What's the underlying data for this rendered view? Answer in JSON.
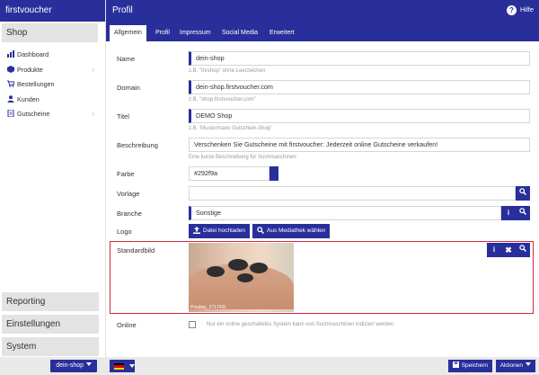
{
  "sidebar": {
    "brand": "firstvoucher",
    "section_shop": "Shop",
    "items": [
      {
        "label": "Dashboard",
        "icon": "dashboard-icon",
        "has_children": false
      },
      {
        "label": "Produkte",
        "icon": "box-icon",
        "has_children": true
      },
      {
        "label": "Bestellungen",
        "icon": "cart-icon",
        "has_children": false
      },
      {
        "label": "Kunden",
        "icon": "user-icon",
        "has_children": false
      },
      {
        "label": "Gutscheine",
        "icon": "document-icon",
        "has_children": true
      }
    ],
    "section_reporting": "Reporting",
    "section_settings": "Einstellungen",
    "section_system": "System",
    "shop_select": "dein-shop"
  },
  "header": {
    "title": "Profil",
    "help_label": "Hilfe",
    "tabs": [
      "Allgemein",
      "Profil",
      "Impressum",
      "Social Media",
      "Erweitert"
    ],
    "active_tab": "Allgemein"
  },
  "form": {
    "name": {
      "label": "Name",
      "value": "dein-shop",
      "hint": "z.B. \"ihrshop\" ohne Leerzeichen"
    },
    "domain": {
      "label": "Domain",
      "value": "dein-shop.firstvoucher.com",
      "hint": "z.B. \"shop.firstvoucher.com\""
    },
    "titel": {
      "label": "Titel",
      "value": "DEMO Shop",
      "hint": "z.B. 'Mustermann Gutschein-Shop'"
    },
    "beschreibung": {
      "label": "Beschreibung",
      "value": "Verschenken Sie Gutscheine mit firstvoucher: Jederzeit online Gutscheine verkaufen!",
      "hint": "Eine kurze Beschreibung für Suchmaschinen"
    },
    "farbe": {
      "label": "Farbe",
      "value": "#292f9a"
    },
    "vorlage": {
      "label": "Vorlage",
      "value": ""
    },
    "branche": {
      "label": "Branche",
      "value": "Sonstige"
    },
    "logo": {
      "label": "Logo",
      "upload_label": "Datei hochladen",
      "library_label": "Aus Mediathek wählen"
    },
    "standardbild": {
      "label": "Standardbild",
      "caption": "Pixabay_2717431"
    },
    "online": {
      "label": "Online",
      "hint": "Nur ein online geschaltetes System kann von Suchmaschinen indiziert werden",
      "checked": false
    }
  },
  "footer": {
    "save_label": "Speichern",
    "actions_label": "Aktionen"
  },
  "colors": {
    "accent": "#292f9a",
    "highlight": "#d0283b"
  }
}
